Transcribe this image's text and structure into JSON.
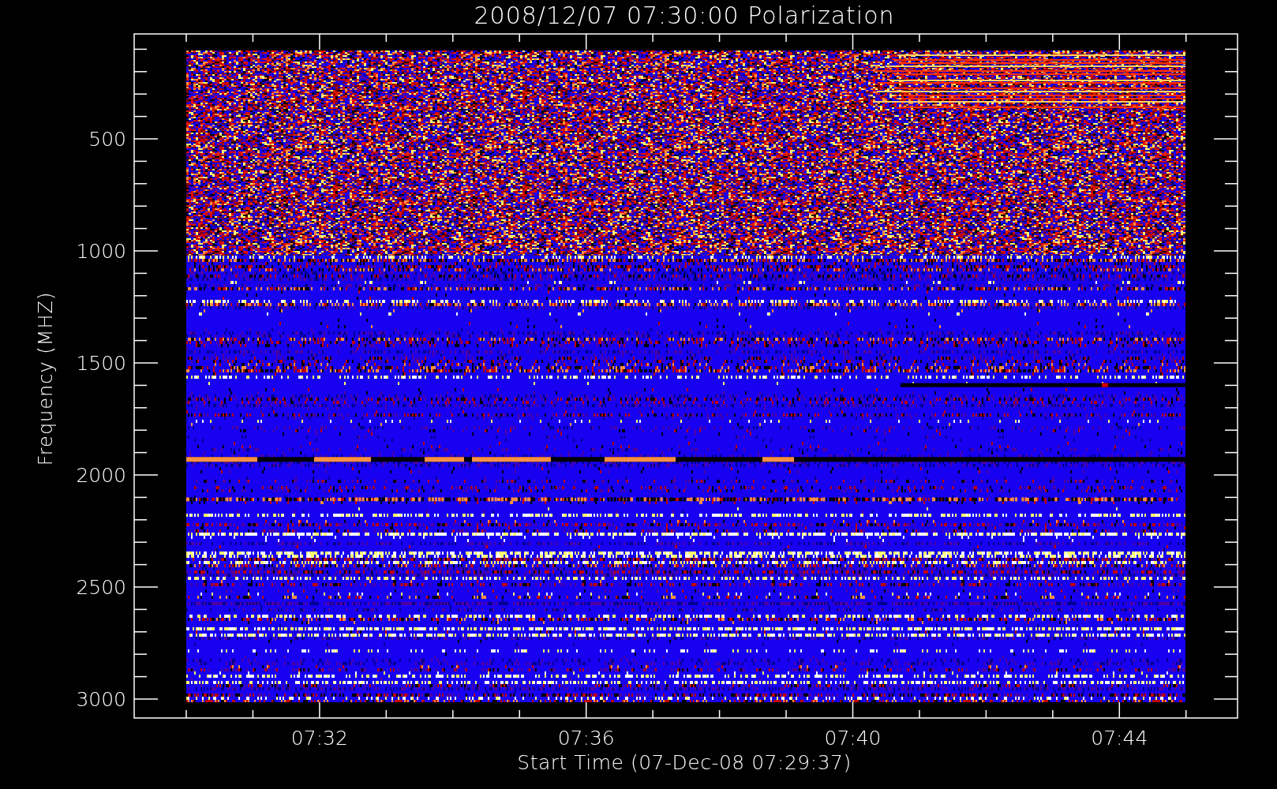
{
  "title": "2008/12/07 07:30:00 Polarization",
  "y_axis": {
    "label": "Frequency (MHZ)",
    "ticks": [
      "500",
      "1000",
      "1500",
      "2000",
      "2500",
      "3000"
    ]
  },
  "x_axis": {
    "label": "Start Time (07-Dec-08 07:29:37)",
    "ticks": [
      "07:32",
      "07:36",
      "07:40",
      "07:44"
    ]
  }
}
